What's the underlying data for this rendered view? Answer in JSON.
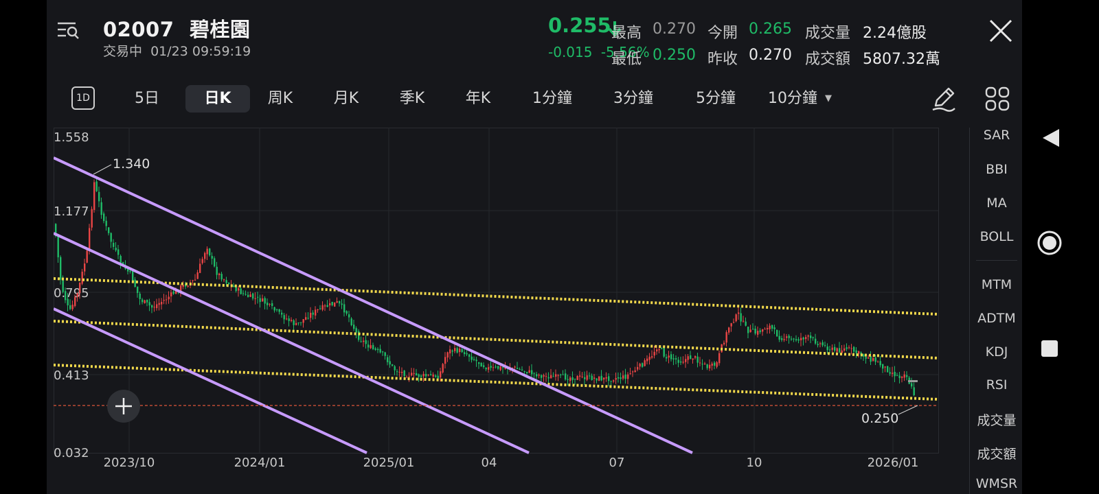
{
  "header": {
    "code": "02007",
    "name": "碧桂園",
    "status": "交易中",
    "datetime": "01/23 09:59:19",
    "price": "0.255",
    "change": "-0.015",
    "change_pct": "-5.56%",
    "high_label": "最高",
    "high": "0.270",
    "open_label": "今開",
    "open": "0.265",
    "volume_label": "成交量",
    "volume": "2.24億股",
    "low_label": "最低",
    "low": "0.250",
    "prev_close_label": "昨收",
    "prev_close": "0.270",
    "turnover_label": "成交額",
    "turnover": "5807.32萬"
  },
  "colors": {
    "up": "#e84545",
    "down": "#1fbb67",
    "channel": "#c79bff",
    "trend": "#f2d94c",
    "price_line": "#e0553a"
  },
  "tabs": [
    {
      "label": "1D",
      "active": false
    },
    {
      "label": "5日",
      "active": false
    },
    {
      "label": "日K",
      "active": true
    },
    {
      "label": "周K",
      "active": false
    },
    {
      "label": "月K",
      "active": false
    },
    {
      "label": "季K",
      "active": false
    },
    {
      "label": "年K",
      "active": false
    },
    {
      "label": "1分鐘",
      "active": false
    },
    {
      "label": "3分鐘",
      "active": false
    },
    {
      "label": "5分鐘",
      "active": false
    },
    {
      "label": "10分鐘",
      "active": false
    }
  ],
  "chart": {
    "y_ticks": [
      "1.558",
      "1.177",
      "0.795",
      "0.413",
      "0.032"
    ],
    "x_ticks": [
      "2023/10",
      "2024/01",
      "2025/01",
      "04",
      "07",
      "10",
      "2026/01"
    ],
    "max_annotation": "1.340",
    "min_annotation": "0.250"
  },
  "indicators": [
    "SAR",
    "BBI",
    "MA",
    "BOLL",
    "MTM",
    "ADTM",
    "KDJ",
    "RSI",
    "成交量",
    "成交額",
    "WMSR"
  ]
}
